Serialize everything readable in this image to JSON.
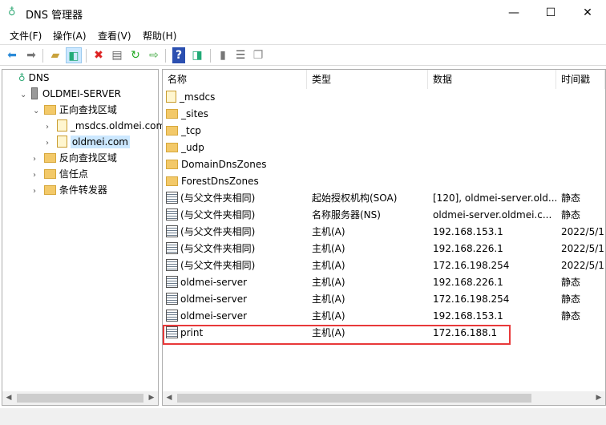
{
  "window": {
    "title": "DNS 管理器",
    "minimize": "—",
    "maximize": "☐",
    "close": "✕"
  },
  "menu": [
    "文件(F)",
    "操作(A)",
    "查看(V)",
    "帮助(H)"
  ],
  "toolbar": [
    "back-icon",
    "forward-icon",
    "up-folder-icon",
    "show-hide-console-tree-icon",
    "delete-icon",
    "properties-icon",
    "refresh-icon",
    "export-list-icon",
    "help-icon",
    "show-action-pane-icon",
    "server-icon",
    "records-list-icon",
    "copy-icon"
  ],
  "tree": [
    {
      "label": "DNS",
      "level": 0,
      "icon": "dns",
      "chev": ""
    },
    {
      "label": "OLDMEI-SERVER",
      "level": 1,
      "icon": "server",
      "chev": "⌄"
    },
    {
      "label": "正向查找区域",
      "level": 2,
      "icon": "folder",
      "chev": "⌄"
    },
    {
      "label": "_msdcs.oldmei.com",
      "level": 3,
      "icon": "zone",
      "chev": "›"
    },
    {
      "label": "oldmei.com",
      "level": 3,
      "icon": "zone",
      "chev": "›",
      "selected": true
    },
    {
      "label": "反向查找区域",
      "level": 2,
      "icon": "folder",
      "chev": "›"
    },
    {
      "label": "信任点",
      "level": 2,
      "icon": "folder",
      "chev": "›"
    },
    {
      "label": "条件转发器",
      "level": 2,
      "icon": "folder",
      "chev": "›"
    }
  ],
  "columns": [
    "名称",
    "类型",
    "数据",
    "时间戳"
  ],
  "rows": [
    {
      "name": "_msdcs",
      "type": "",
      "data": "",
      "ts": "",
      "icon": "zone"
    },
    {
      "name": "_sites",
      "type": "",
      "data": "",
      "ts": "",
      "icon": "folder"
    },
    {
      "name": "_tcp",
      "type": "",
      "data": "",
      "ts": "",
      "icon": "folder"
    },
    {
      "name": "_udp",
      "type": "",
      "data": "",
      "ts": "",
      "icon": "folder"
    },
    {
      "name": "DomainDnsZones",
      "type": "",
      "data": "",
      "ts": "",
      "icon": "folder"
    },
    {
      "name": "ForestDnsZones",
      "type": "",
      "data": "",
      "ts": "",
      "icon": "folder"
    },
    {
      "name": "(与父文件夹相同)",
      "type": "起始授权机构(SOA)",
      "data": "[120], oldmei-server.old...",
      "ts": "静态",
      "icon": "rec"
    },
    {
      "name": "(与父文件夹相同)",
      "type": "名称服务器(NS)",
      "data": "oldmei-server.oldmei.c...",
      "ts": "静态",
      "icon": "rec"
    },
    {
      "name": "(与父文件夹相同)",
      "type": "主机(A)",
      "data": "192.168.153.1",
      "ts": "2022/5/1",
      "icon": "rec"
    },
    {
      "name": "(与父文件夹相同)",
      "type": "主机(A)",
      "data": "192.168.226.1",
      "ts": "2022/5/1",
      "icon": "rec"
    },
    {
      "name": "(与父文件夹相同)",
      "type": "主机(A)",
      "data": "172.16.198.254",
      "ts": "2022/5/1",
      "icon": "rec"
    },
    {
      "name": "oldmei-server",
      "type": "主机(A)",
      "data": "192.168.226.1",
      "ts": "静态",
      "icon": "rec"
    },
    {
      "name": "oldmei-server",
      "type": "主机(A)",
      "data": "172.16.198.254",
      "ts": "静态",
      "icon": "rec"
    },
    {
      "name": "oldmei-server",
      "type": "主机(A)",
      "data": "192.168.153.1",
      "ts": "静态",
      "icon": "rec"
    },
    {
      "name": "print",
      "type": "主机(A)",
      "data": "172.16.188.1",
      "ts": "",
      "icon": "rec"
    }
  ],
  "colors": {
    "highlight": "#e8393a",
    "selected": "#cce8ff"
  }
}
